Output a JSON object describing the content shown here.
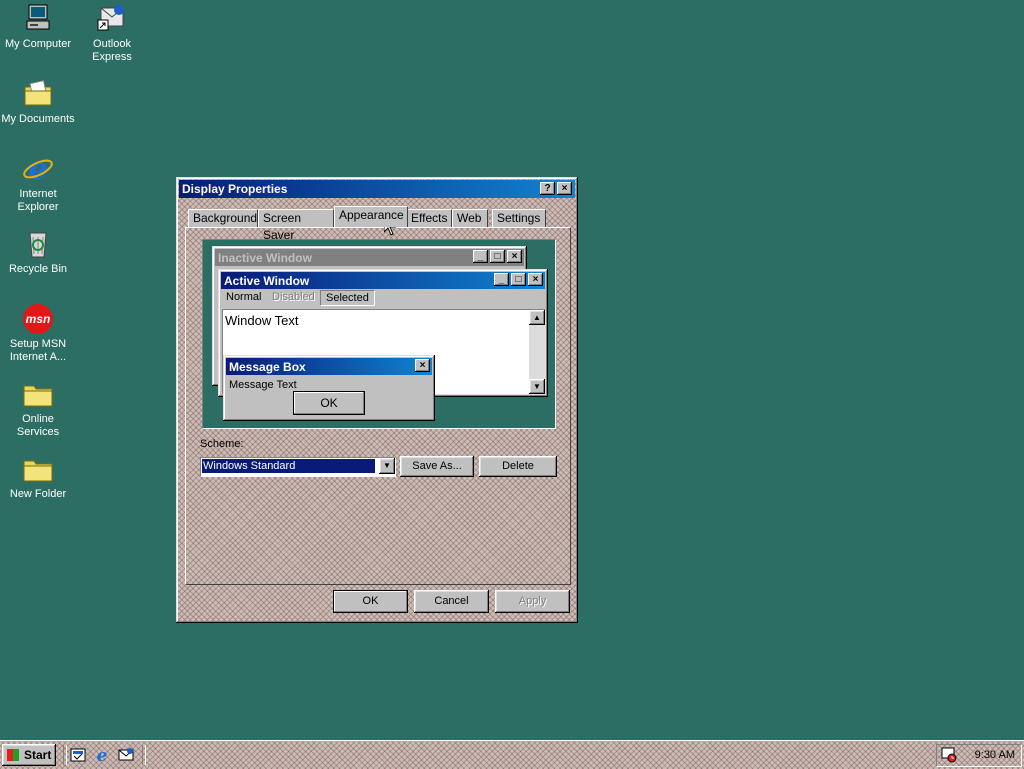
{
  "desktop": {
    "icons": [
      {
        "label": "My Computer"
      },
      {
        "label": "Outlook Express"
      },
      {
        "label": "My Documents"
      },
      {
        "label": "Internet Explorer"
      },
      {
        "label": "Recycle Bin"
      },
      {
        "label": "Setup MSN Internet A..."
      },
      {
        "label": "Online Services"
      },
      {
        "label": "New Folder"
      }
    ],
    "background_color": "#2c6e63"
  },
  "dialog": {
    "title": "Display Properties",
    "help_glyph": "?",
    "close_glyph": "×",
    "tabs": [
      {
        "label": "Background"
      },
      {
        "label": "Screen Saver"
      },
      {
        "label": "Appearance"
      },
      {
        "label": "Effects"
      },
      {
        "label": "Web"
      },
      {
        "label": "Settings"
      }
    ],
    "preview": {
      "inactive_title": "Inactive Window",
      "active_title": "Active Window",
      "menu_items": [
        {
          "label": "Normal"
        },
        {
          "label": "Disabled"
        },
        {
          "label": "Selected"
        }
      ],
      "window_text": "Window Text",
      "msgbox_title": "Message Box",
      "msgbox_text": "Message Text",
      "msgbox_ok": "OK"
    },
    "scheme_label": "Scheme:",
    "scheme_value": "Windows Standard",
    "save_as": "Save As...",
    "delete": "Delete",
    "ok": "OK",
    "cancel": "Cancel",
    "apply": "Apply"
  },
  "taskbar": {
    "start": "Start",
    "clock": "9:30 AM"
  },
  "colors": {
    "active_title_start": "#0a1a78",
    "active_title_end": "#1084d0",
    "inactive_title": "#808080",
    "selection": "#0a1a78"
  }
}
